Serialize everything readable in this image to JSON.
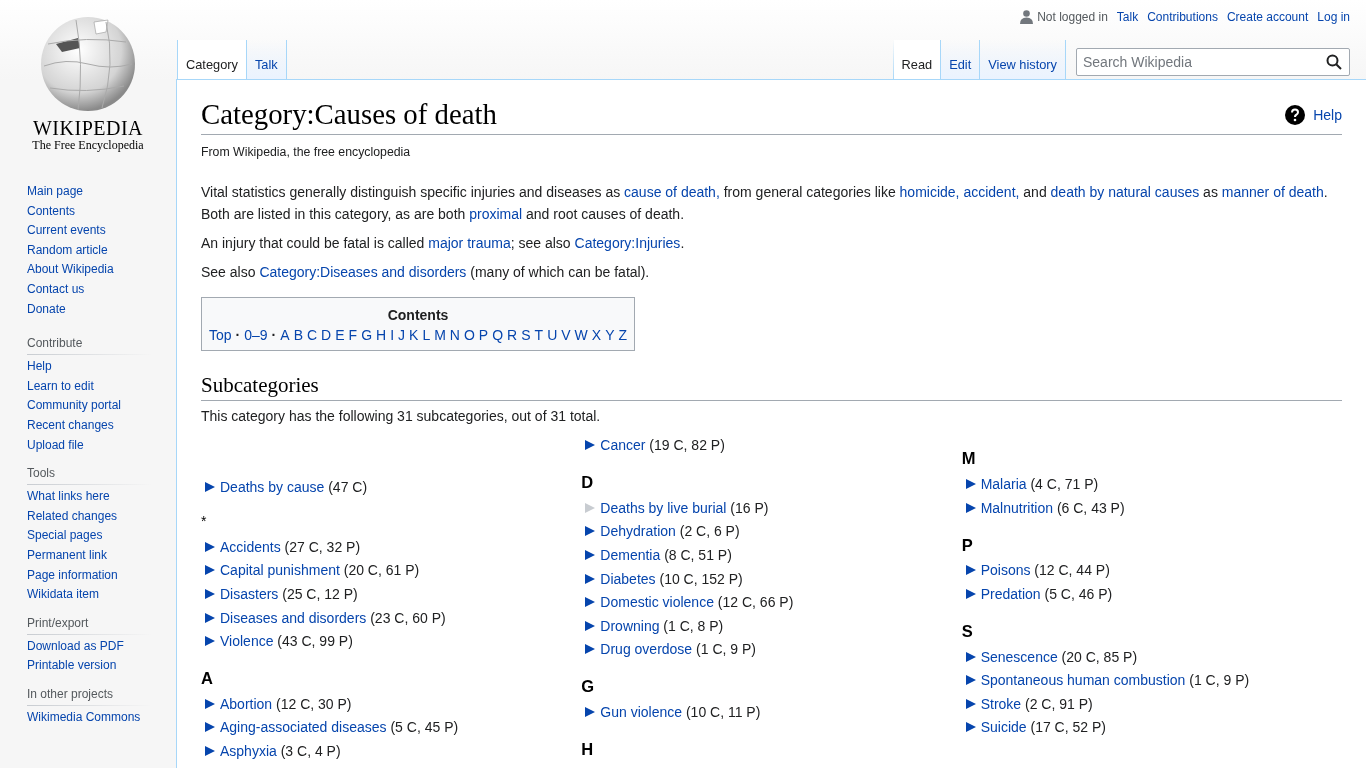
{
  "sidebar": {
    "logo": {
      "wordmark": "WIKIPEDIA",
      "tagline": "The Free Encyclopedia"
    },
    "sections": [
      {
        "items": [
          "Main page",
          "Contents",
          "Current events",
          "Random article",
          "About Wikipedia",
          "Contact us",
          "Donate"
        ]
      },
      {
        "heading": "Contribute",
        "items": [
          "Help",
          "Learn to edit",
          "Community portal",
          "Recent changes",
          "Upload file"
        ]
      },
      {
        "heading": "Tools",
        "items": [
          "What links here",
          "Related changes",
          "Special pages",
          "Permanent link",
          "Page information",
          "Wikidata item"
        ]
      },
      {
        "heading": "Print/export",
        "items": [
          "Download as PDF",
          "Printable version"
        ]
      },
      {
        "heading": "In other projects",
        "items": [
          "Wikimedia Commons"
        ]
      }
    ]
  },
  "personal_tools": {
    "status": "Not logged in",
    "links": [
      "Talk",
      "Contributions",
      "Create account",
      "Log in"
    ]
  },
  "left_tabs": [
    {
      "label": "Category",
      "selected": true
    },
    {
      "label": "Talk",
      "selected": false
    }
  ],
  "right_tabs": [
    {
      "label": "Read",
      "selected": true
    },
    {
      "label": "Edit",
      "selected": false
    },
    {
      "label": "View history",
      "selected": false
    }
  ],
  "search": {
    "placeholder": "Search Wikipedia"
  },
  "page": {
    "title": "Category:Causes of death",
    "help": "Help",
    "tagline": "From Wikipedia, the free encyclopedia",
    "paragraphs": [
      [
        {
          "text": "Vital statistics generally distinguish specific injuries and diseases as ",
          "link": false
        },
        {
          "text": "cause of death,",
          "link": true
        },
        {
          "text": " from general categories like ",
          "link": false
        },
        {
          "text": "homicide, accident,",
          "link": true
        },
        {
          "text": " and ",
          "link": false
        },
        {
          "text": "death by natural causes",
          "link": true
        },
        {
          "text": " as ",
          "link": false
        },
        {
          "text": "manner of death",
          "link": true
        },
        {
          "text": ". Both are listed in this category, as are both ",
          "link": false
        },
        {
          "text": "proximal",
          "link": true
        },
        {
          "text": " and root causes of death.",
          "link": false
        }
      ],
      [
        {
          "text": "An injury that could be fatal is called ",
          "link": false
        },
        {
          "text": "major trauma",
          "link": true
        },
        {
          "text": "; see also ",
          "link": false
        },
        {
          "text": "Category:Injuries",
          "link": true
        },
        {
          "text": ".",
          "link": false
        }
      ],
      [
        {
          "text": "See also ",
          "link": false
        },
        {
          "text": "Category:Diseases and disorders",
          "link": true
        },
        {
          "text": " (many of which can be fatal).",
          "link": false
        }
      ]
    ],
    "toc": {
      "title": "Contents",
      "entries": [
        {
          "text": "Top",
          "kind": "link"
        },
        {
          "text": "·",
          "kind": "separator"
        },
        {
          "text": "0–9",
          "kind": "link"
        },
        {
          "text": "·",
          "kind": "separator"
        },
        {
          "text": "A",
          "kind": "link"
        },
        {
          "text": "B",
          "kind": "link"
        },
        {
          "text": "C",
          "kind": "link"
        },
        {
          "text": "D",
          "kind": "link"
        },
        {
          "text": "E",
          "kind": "link"
        },
        {
          "text": "F",
          "kind": "link"
        },
        {
          "text": "G",
          "kind": "link"
        },
        {
          "text": "H",
          "kind": "link"
        },
        {
          "text": "I",
          "kind": "link"
        },
        {
          "text": "J",
          "kind": "link"
        },
        {
          "text": "K",
          "kind": "link"
        },
        {
          "text": "L",
          "kind": "link"
        },
        {
          "text": "M",
          "kind": "link"
        },
        {
          "text": "N",
          "kind": "link"
        },
        {
          "text": "O",
          "kind": "link"
        },
        {
          "text": "P",
          "kind": "link"
        },
        {
          "text": "Q",
          "kind": "link"
        },
        {
          "text": "R",
          "kind": "link"
        },
        {
          "text": "S",
          "kind": "link"
        },
        {
          "text": "T",
          "kind": "link"
        },
        {
          "text": "U",
          "kind": "link"
        },
        {
          "text": "V",
          "kind": "link"
        },
        {
          "text": "W",
          "kind": "link"
        },
        {
          "text": "X",
          "kind": "link"
        },
        {
          "text": "Y",
          "kind": "link"
        },
        {
          "text": "Z",
          "kind": "link"
        }
      ]
    },
    "subcategories": {
      "heading": "Subcategories",
      "summary": "This category has the following 31 subcategories, out of 31 total.",
      "columns": [
        {
          "groups": [
            {
              "kind": "untitled",
              "items": [
                {
                  "name": "Deaths by cause",
                  "count": "(47 C)",
                  "expandable": true
                }
              ]
            },
            {
              "kind": "titled",
              "heading": "*",
              "items": [
                {
                  "name": "Accidents",
                  "count": "(27 C, 32 P)",
                  "expandable": true
                },
                {
                  "name": "Capital punishment",
                  "count": "(20 C, 61 P)",
                  "expandable": true
                },
                {
                  "name": "Disasters",
                  "count": "(25 C, 12 P)",
                  "expandable": true
                },
                {
                  "name": "Diseases and disorders",
                  "count": "(23 C, 60 P)",
                  "expandable": true
                },
                {
                  "name": "Violence",
                  "count": "(43 C, 99 P)",
                  "expandable": true
                }
              ]
            },
            {
              "kind": "titled",
              "heading": "A",
              "items": [
                {
                  "name": "Abortion",
                  "count": "(12 C, 30 P)",
                  "expandable": true
                },
                {
                  "name": "Aging-associated diseases",
                  "count": "(5 C, 45 P)",
                  "expandable": true
                },
                {
                  "name": "Asphyxia",
                  "count": "(3 C, 4 P)",
                  "expandable": true
                }
              ]
            }
          ]
        },
        {
          "groups": [
            {
              "kind": "continued",
              "items": [
                {
                  "name": "Cancer",
                  "count": "(19 C, 82 P)",
                  "expandable": true
                }
              ]
            },
            {
              "kind": "titled",
              "heading": "D",
              "items": [
                {
                  "name": "Deaths by live burial",
                  "count": "(16 P)",
                  "expandable": false
                },
                {
                  "name": "Dehydration",
                  "count": "(2 C, 6 P)",
                  "expandable": true
                },
                {
                  "name": "Dementia",
                  "count": "(8 C, 51 P)",
                  "expandable": true
                },
                {
                  "name": "Diabetes",
                  "count": "(10 C, 152 P)",
                  "expandable": true
                },
                {
                  "name": "Domestic violence",
                  "count": "(12 C, 66 P)",
                  "expandable": true
                },
                {
                  "name": "Drowning",
                  "count": "(1 C, 8 P)",
                  "expandable": true
                },
                {
                  "name": "Drug overdose",
                  "count": "(1 C, 9 P)",
                  "expandable": true
                }
              ]
            },
            {
              "kind": "titled",
              "heading": "G",
              "items": [
                {
                  "name": "Gun violence",
                  "count": "(10 C, 11 P)",
                  "expandable": true
                }
              ]
            },
            {
              "kind": "titled",
              "heading": "H"
            }
          ]
        },
        {
          "groups": [
            {
              "kind": "titled",
              "heading": "M",
              "items": [
                {
                  "name": "Malaria",
                  "count": "(4 C, 71 P)",
                  "expandable": true
                },
                {
                  "name": "Malnutrition",
                  "count": "(6 C, 43 P)",
                  "expandable": true
                }
              ]
            },
            {
              "kind": "titled",
              "heading": "P",
              "items": [
                {
                  "name": "Poisons",
                  "count": "(12 C, 44 P)",
                  "expandable": true
                },
                {
                  "name": "Predation",
                  "count": "(5 C, 46 P)",
                  "expandable": true
                }
              ]
            },
            {
              "kind": "titled",
              "heading": "S",
              "items": [
                {
                  "name": "Senescence",
                  "count": "(20 C, 85 P)",
                  "expandable": true
                },
                {
                  "name": "Spontaneous human combustion",
                  "count": "(1 C, 9 P)",
                  "expandable": true
                },
                {
                  "name": "Stroke",
                  "count": "(2 C, 91 P)",
                  "expandable": true
                },
                {
                  "name": "Suicide",
                  "count": "(17 C, 52 P)",
                  "expandable": true
                }
              ]
            }
          ]
        }
      ]
    }
  }
}
